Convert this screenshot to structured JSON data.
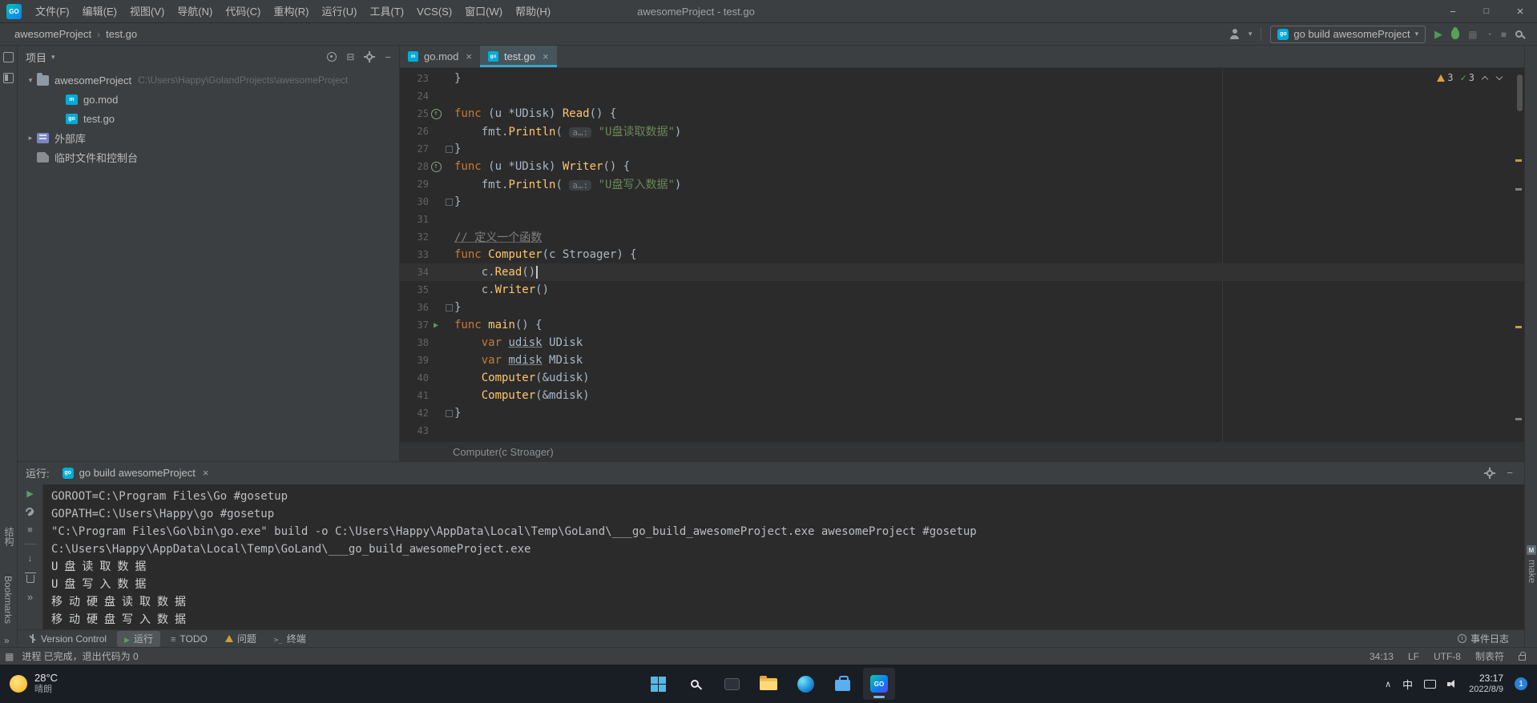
{
  "titlebar": {
    "app_badge": "GO",
    "menus": [
      "文件(F)",
      "编辑(E)",
      "视图(V)",
      "导航(N)",
      "代码(C)",
      "重构(R)",
      "运行(U)",
      "工具(T)",
      "VCS(S)",
      "窗口(W)",
      "帮助(H)"
    ],
    "title": "awesomeProject - test.go"
  },
  "navbar": {
    "breadcrumbs": [
      "awesomeProject",
      "test.go"
    ],
    "run_config": "go build awesomeProject"
  },
  "left_strip": {
    "structure_label": "结构",
    "bookmarks_label": "Bookmarks",
    "more": "»"
  },
  "right_strip": {
    "make_label": "make"
  },
  "project": {
    "header": "项目",
    "items": [
      {
        "indent": 0,
        "chevron": "▾",
        "icon": "folder",
        "label": "awesomeProject",
        "hint": "C:\\Users\\Happy\\GolandProjects\\awesomeProject"
      },
      {
        "indent": 1,
        "chevron": "",
        "icon": "gomod",
        "label": "go.mod",
        "hint": ""
      },
      {
        "indent": 1,
        "chevron": "",
        "icon": "gofile",
        "label": "test.go",
        "hint": ""
      },
      {
        "indent": 0,
        "chevron": "▸",
        "icon": "lib",
        "label": "外部库",
        "hint": ""
      },
      {
        "indent": 0,
        "chevron": "",
        "icon": "scratch",
        "label": "临时文件和控制台",
        "hint": ""
      }
    ]
  },
  "tabs": [
    {
      "label": "go.mod",
      "icon": "gomod",
      "active": false
    },
    {
      "label": "test.go",
      "icon": "gofile",
      "active": true
    }
  ],
  "inspections": {
    "warnings": 3,
    "passed": 3
  },
  "editor": {
    "context": "Computer(c Stroager)",
    "lines": [
      {
        "n": 23,
        "t": [
          [
            "}",
            "d"
          ]
        ]
      },
      {
        "n": 24,
        "t": []
      },
      {
        "n": 25,
        "g": "impl",
        "t": [
          [
            "func",
            "k"
          ],
          [
            " (u *UDisk) ",
            "d"
          ],
          [
            "Read",
            "f"
          ],
          [
            "() {",
            "d"
          ]
        ]
      },
      {
        "n": 26,
        "t": [
          [
            "    fmt.",
            "d"
          ],
          [
            "Println",
            "f"
          ],
          [
            "( ",
            "d"
          ],
          [
            "a…:",
            "h"
          ],
          [
            " ",
            "d"
          ],
          [
            "\"U盘读取数据\"",
            "s"
          ],
          [
            ")",
            "d"
          ]
        ]
      },
      {
        "n": 27,
        "fold": "end",
        "t": [
          [
            "}",
            "d"
          ]
        ]
      },
      {
        "n": 28,
        "g": "impl",
        "t": [
          [
            "func",
            "k"
          ],
          [
            " (u *UDisk) ",
            "d"
          ],
          [
            "Writer",
            "f"
          ],
          [
            "() {",
            "d"
          ]
        ]
      },
      {
        "n": 29,
        "t": [
          [
            "    fmt.",
            "d"
          ],
          [
            "Println",
            "f"
          ],
          [
            "( ",
            "d"
          ],
          [
            "a…:",
            "h"
          ],
          [
            " ",
            "d"
          ],
          [
            "\"U盘写入数据\"",
            "s"
          ],
          [
            ")",
            "d"
          ]
        ]
      },
      {
        "n": 30,
        "fold": "end",
        "t": [
          [
            "}",
            "d"
          ]
        ]
      },
      {
        "n": 31,
        "t": []
      },
      {
        "n": 32,
        "t": [
          [
            "// 定义一个函数",
            "c"
          ]
        ]
      },
      {
        "n": 33,
        "t": [
          [
            "func ",
            "k"
          ],
          [
            "Computer",
            "f"
          ],
          [
            "(c ",
            "d"
          ],
          [
            "Stroager",
            "t"
          ],
          [
            ") {",
            "d"
          ]
        ]
      },
      {
        "n": 34,
        "current": true,
        "caret": true,
        "t": [
          [
            "    c.",
            "d"
          ],
          [
            "Read",
            "f"
          ],
          [
            "()",
            "d"
          ]
        ]
      },
      {
        "n": 35,
        "t": [
          [
            "    c.",
            "d"
          ],
          [
            "Writer",
            "f"
          ],
          [
            "()",
            "d"
          ]
        ]
      },
      {
        "n": 36,
        "fold": "end",
        "t": [
          [
            "}",
            "d"
          ]
        ]
      },
      {
        "n": 37,
        "g": "run",
        "t": [
          [
            "func ",
            "k"
          ],
          [
            "main",
            "f"
          ],
          [
            "() {",
            "d"
          ]
        ]
      },
      {
        "n": 38,
        "t": [
          [
            "    ",
            "d"
          ],
          [
            "var",
            "k"
          ],
          [
            " ",
            "d"
          ],
          [
            "udisk",
            "v"
          ],
          [
            " ",
            "d"
          ],
          [
            "UDisk",
            "t"
          ]
        ]
      },
      {
        "n": 39,
        "t": [
          [
            "    ",
            "d"
          ],
          [
            "var",
            "k"
          ],
          [
            " ",
            "d"
          ],
          [
            "mdisk",
            "v"
          ],
          [
            " ",
            "d"
          ],
          [
            "MDisk",
            "t"
          ]
        ]
      },
      {
        "n": 40,
        "t": [
          [
            "    ",
            "d"
          ],
          [
            "Computer",
            "f"
          ],
          [
            "(&udisk)",
            "d"
          ]
        ]
      },
      {
        "n": 41,
        "t": [
          [
            "    ",
            "d"
          ],
          [
            "Computer",
            "f"
          ],
          [
            "(&mdisk)",
            "d"
          ]
        ]
      },
      {
        "n": 42,
        "fold": "end",
        "t": [
          [
            "}",
            "d"
          ]
        ]
      },
      {
        "n": 43,
        "t": []
      }
    ]
  },
  "run": {
    "panel_title": "运行:",
    "tab_label": "go build awesomeProject",
    "console": [
      {
        "text": "GOROOT=C:\\Program Files\\Go #gosetup",
        "cjk": false
      },
      {
        "text": "GOPATH=C:\\Users\\Happy\\go #gosetup",
        "cjk": false
      },
      {
        "text": "\"C:\\Program Files\\Go\\bin\\go.exe\" build -o C:\\Users\\Happy\\AppData\\Local\\Temp\\GoLand\\___go_build_awesomeProject.exe awesomeProject #gosetup",
        "cjk": false
      },
      {
        "text": "C:\\Users\\Happy\\AppData\\Local\\Temp\\GoLand\\___go_build_awesomeProject.exe",
        "cjk": false
      },
      {
        "text": "U盘读取数据",
        "cjk": true
      },
      {
        "text": "U盘写入数据",
        "cjk": true
      },
      {
        "text": "移动硬盘读取数据",
        "cjk": true
      },
      {
        "text": "移动硬盘写入数据",
        "cjk": true
      }
    ]
  },
  "toolbuttons": {
    "left": [
      {
        "label": "Version Control",
        "icon": "vcs",
        "active": false
      },
      {
        "label": "运行",
        "icon": "run",
        "active": true
      },
      {
        "label": "TODO",
        "icon": "todo",
        "active": false
      },
      {
        "label": "问题",
        "icon": "problems",
        "active": false
      },
      {
        "label": "终端",
        "icon": "terminal",
        "active": false
      }
    ],
    "right": [
      {
        "label": "事件日志",
        "icon": "eventlog",
        "active": false
      }
    ]
  },
  "status": {
    "message": "进程 已完成，退出代码为 0",
    "position": "34:13",
    "line_ending": "LF",
    "encoding": "UTF-8",
    "indent": "制表符"
  },
  "taskbar": {
    "weather_temp": "28°C",
    "weather_desc": "晴朗",
    "goland_label": "GO",
    "ime": "中",
    "time": "23:17",
    "date": "2022/8/9",
    "badge": "1"
  }
}
